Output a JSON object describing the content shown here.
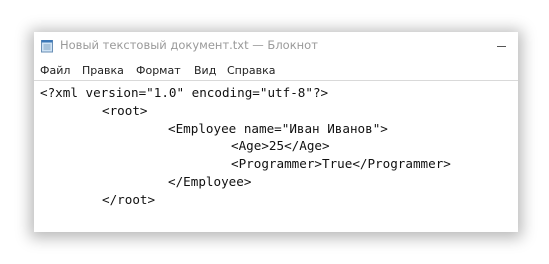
{
  "window": {
    "title": "Новый текстовый документ.txt — Блокнот"
  },
  "menu": {
    "items": [
      "Файл",
      "Правка",
      "Формат",
      "Вид",
      "Справка"
    ]
  },
  "editor": {
    "lines": [
      "<?xml version=\"1.0\" encoding=\"utf-8\"?>",
      "<root>",
      "<Employee name=\"Иван Иванов\">",
      "<Age>25</Age>",
      "<Programmer>True</Programmer>",
      "</Employee>",
      "</root>"
    ]
  },
  "icons": {
    "app": "notepad-icon",
    "minimize": "minimize-icon"
  }
}
